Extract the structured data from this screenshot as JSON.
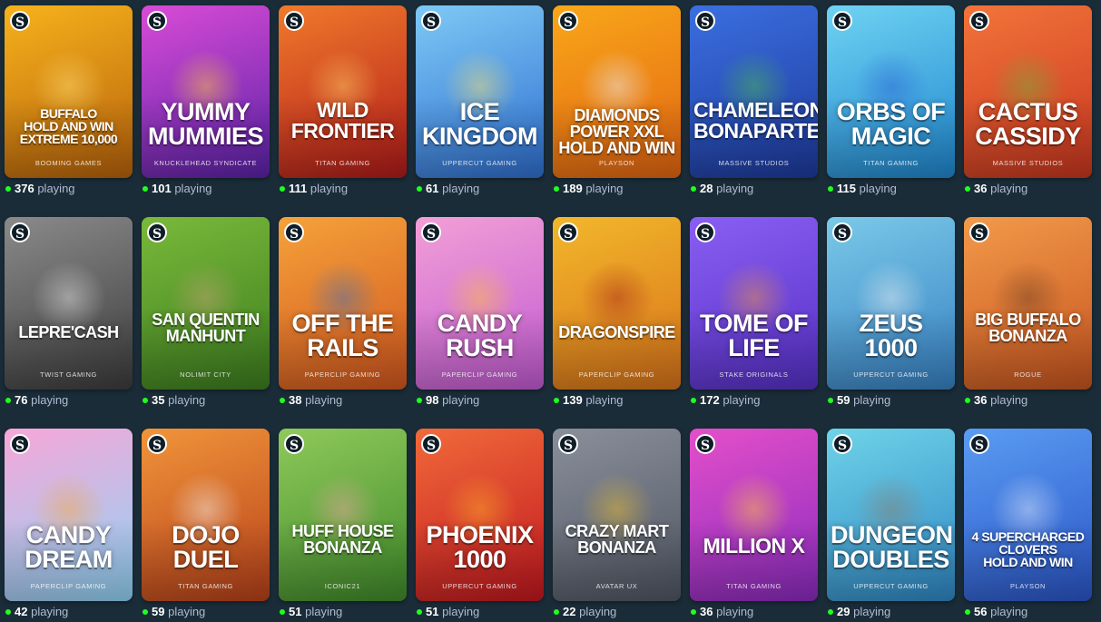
{
  "icons": {
    "provider_badge": "stake-s-logo-icon",
    "live_indicator": "green-dot-icon"
  },
  "live_dot_color": "#1fff20",
  "players_suffix": "playing",
  "games": [
    {
      "title_lines": [
        "BUFFALO",
        "HOLD AND WIN",
        "EXTREME 10,000"
      ],
      "studio": "BOOMING GAMES",
      "players": "376",
      "colors": [
        "#f6b21c",
        "#b8620b"
      ],
      "accent": "#ffe27a"
    },
    {
      "title_lines": [
        "YUMMY",
        "MUMMIES"
      ],
      "studio": "KNUCKLEHEAD SYNDICATE",
      "players": "101",
      "colors": [
        "#d94bd6",
        "#5a22a8"
      ],
      "accent": "#ffd23b"
    },
    {
      "title_lines": [
        "WILD",
        "FRONTIER"
      ],
      "studio": "TITAN GAMING",
      "players": "111",
      "colors": [
        "#f07a2b",
        "#b21a1a"
      ],
      "accent": "#ffd56a"
    },
    {
      "title_lines": [
        "ICE",
        "KINGDOM"
      ],
      "studio": "UPPERCUT GAMING",
      "players": "61",
      "colors": [
        "#7ec9f5",
        "#2f6fd1"
      ],
      "accent": "#ffe36b"
    },
    {
      "title_lines": [
        "DIAMONDS",
        "POWER XXL",
        "HOLD AND WIN"
      ],
      "studio": "PLAYSON",
      "players": "189",
      "colors": [
        "#f8a719",
        "#e46512"
      ],
      "accent": "#e8f3ff"
    },
    {
      "title_lines": [
        "CHAMELEON",
        "BONAPARTE"
      ],
      "studio": "MASSIVE STUDIOS",
      "players": "28",
      "colors": [
        "#3b6fe0",
        "#1d3a9c"
      ],
      "accent": "#4cc24a"
    },
    {
      "title_lines": [
        "ORBS OF",
        "MAGIC"
      ],
      "studio": "TITAN GAMING",
      "players": "115",
      "colors": [
        "#6fd3f2",
        "#1f86cf"
      ],
      "accent": "#2a5fd6"
    },
    {
      "title_lines": [
        "CACTUS",
        "CASSIDY"
      ],
      "studio": "MASSIVE STUDIOS",
      "players": "36",
      "colors": [
        "#f2743a",
        "#c8361f"
      ],
      "accent": "#6fb13c"
    },
    {
      "title_lines": [
        "LEPRE'CASH"
      ],
      "studio": "TWIST GAMING",
      "players": "76",
      "colors": [
        "#8a8a8a",
        "#3c3c3c"
      ],
      "accent": "#eaeaea"
    },
    {
      "title_lines": [
        "SAN QUENTIN",
        "MANHUNT"
      ],
      "studio": "NOLIMIT CITY",
      "players": "35",
      "colors": [
        "#7ab93a",
        "#3c7d1f"
      ],
      "accent": "#c9a27a"
    },
    {
      "title_lines": [
        "OFF THE",
        "RAILS"
      ],
      "studio": "PAPERCLIP GAMING",
      "players": "38",
      "colors": [
        "#f5a23a",
        "#d2571f"
      ],
      "accent": "#3c6fb8"
    },
    {
      "title_lines": [
        "CANDY",
        "RUSH"
      ],
      "studio": "PAPERCLIP GAMING",
      "players": "98",
      "colors": [
        "#f29fd6",
        "#c25bd2"
      ],
      "accent": "#ffc436"
    },
    {
      "title_lines": [
        "DRAGONSPIRE"
      ],
      "studio": "PAPERCLIP GAMING",
      "players": "139",
      "colors": [
        "#f2b72b",
        "#d8731a"
      ],
      "accent": "#a1231a"
    },
    {
      "title_lines": [
        "TOME OF",
        "LIFE"
      ],
      "studio": "STAKE ORIGINALS",
      "players": "172",
      "colors": [
        "#8a5ef2",
        "#5630c7"
      ],
      "accent": "#f29a3a"
    },
    {
      "title_lines": [
        "ZEUS",
        "1000"
      ],
      "studio": "UPPERCUT GAMING",
      "players": "59",
      "colors": [
        "#7ac9e8",
        "#3781c4"
      ],
      "accent": "#f2f2f2"
    },
    {
      "title_lines": [
        "BIG BUFFALO",
        "BONANZA"
      ],
      "studio": "ROGUE",
      "players": "36",
      "colors": [
        "#f29a4a",
        "#c7541f"
      ],
      "accent": "#6a3e22"
    },
    {
      "title_lines": [
        "CANDY",
        "DREAM"
      ],
      "studio": "PAPERCLIP GAMING",
      "players": "42",
      "colors": [
        "#f7a7d8",
        "#8fd3f5"
      ],
      "accent": "#f5a83c"
    },
    {
      "title_lines": [
        "DOJO",
        "DUEL"
      ],
      "studio": "TITAN GAMING",
      "players": "59",
      "colors": [
        "#f0953a",
        "#b8401a"
      ],
      "accent": "#f5f5f5"
    },
    {
      "title_lines": [
        "HUFF HOUSE",
        "BONANZA"
      ],
      "studio": "ICONIC21",
      "players": "51",
      "colors": [
        "#8fc95a",
        "#3f8a2a"
      ],
      "accent": "#f2a5a5"
    },
    {
      "title_lines": [
        "PHOENIX",
        "1000"
      ],
      "studio": "UPPERCUT GAMING",
      "players": "51",
      "colors": [
        "#f06a3a",
        "#c2171f"
      ],
      "accent": "#ffb32b"
    },
    {
      "title_lines": [
        "CRAZY MART",
        "BONANZA"
      ],
      "studio": "AVATAR UX",
      "players": "22",
      "colors": [
        "#8a8f9a",
        "#4f5562"
      ],
      "accent": "#f2c12b"
    },
    {
      "title_lines": [
        "MILLION X"
      ],
      "studio": "TITAN GAMING",
      "players": "36",
      "colors": [
        "#e44fc9",
        "#8a2bbf"
      ],
      "accent": "#ffd23b"
    },
    {
      "title_lines": [
        "DUNGEON",
        "DOUBLES"
      ],
      "studio": "UPPERCUT GAMING",
      "players": "29",
      "colors": [
        "#6fd3e8",
        "#2f87c4"
      ],
      "accent": "#8a7a6a"
    },
    {
      "title_lines": [
        "4 SUPERCHARGED",
        "CLOVERS",
        "HOLD AND WIN"
      ],
      "studio": "PLAYSON",
      "players": "56",
      "colors": [
        "#5a9cf2",
        "#2a55c8"
      ],
      "accent": "#e8f0ff"
    }
  ]
}
